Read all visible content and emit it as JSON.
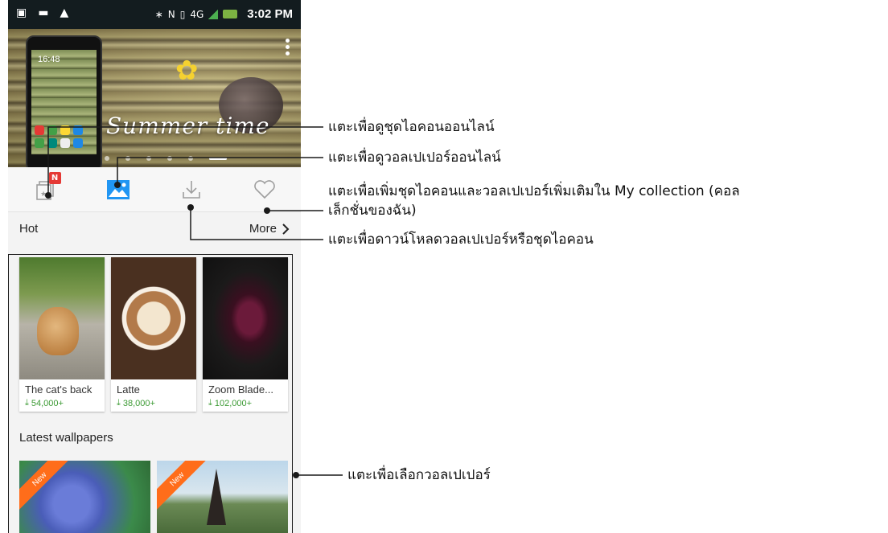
{
  "status_bar": {
    "time": "3:02 PM",
    "left_icons": [
      "notification-icon",
      "image-icon",
      "warning-icon"
    ],
    "right_icons": [
      "bluetooth-icon",
      "nfc-icon",
      "vibrate-icon",
      "4g-icon",
      "signal-icon",
      "battery-charging-icon"
    ]
  },
  "banner": {
    "title": "Summer time",
    "mini_clock": "16:48",
    "page_count": 6,
    "active_page": 5
  },
  "tabs": [
    {
      "name": "tab-icon-packs",
      "icon": "icon-pack-icon",
      "badge": "N",
      "active": false
    },
    {
      "name": "tab-wallpapers",
      "icon": "wallpaper-icon",
      "active": true
    },
    {
      "name": "tab-downloads",
      "icon": "download-icon",
      "active": false
    },
    {
      "name": "tab-my-collection",
      "icon": "heart-icon",
      "active": false
    }
  ],
  "hot": {
    "title": "Hot",
    "more_label": "More",
    "items": [
      {
        "title": "The cat's back",
        "downloads": "54,000+"
      },
      {
        "title": "Latte",
        "downloads": "38,000+"
      },
      {
        "title": "Zoom Blade...",
        "downloads": "102,000+"
      }
    ]
  },
  "latest": {
    "title": "Latest wallpapers",
    "badge": "New",
    "items": [
      {
        "badge": "New"
      },
      {
        "badge": "New"
      }
    ]
  },
  "callouts": [
    {
      "text": "แตะเพื่อดูชุดไอคอนออนไลน์"
    },
    {
      "text": "แตะเพื่อดูวอลเปเปอร์ออนไลน์"
    },
    {
      "line1": "แตะเพื่อเพิ่มชุดไอคอนและวอลเปเปอร์เพิ่มเติมใน My collection (คอล",
      "line2": "เล็กชั่นของฉัน)"
    },
    {
      "text": "แตะเพื่อดาวน์โหลดวอลเปเปอร์หรือชุดไอคอน"
    },
    {
      "text": "แตะเพื่อเลือกวอลเปเปอร์"
    }
  ],
  "colors": {
    "status_bar_bg": "#131c1f",
    "accent_blue": "#2196f3",
    "download_green": "#3d9b35",
    "new_ribbon": "#ff6d1a",
    "badge_red": "#e53935"
  }
}
